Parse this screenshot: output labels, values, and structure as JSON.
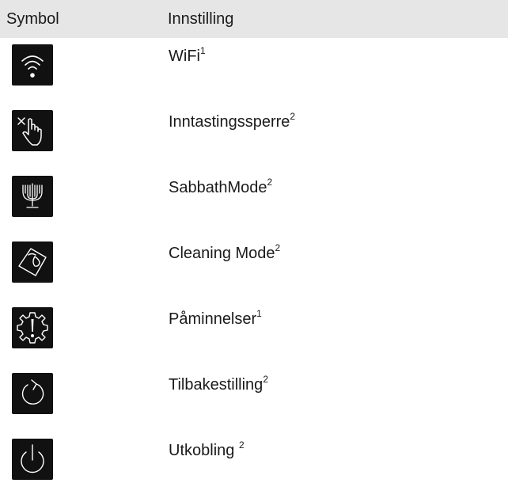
{
  "table": {
    "headers": {
      "symbol": "Symbol",
      "setting": "Innstilling"
    },
    "rows": [
      {
        "icon": "wifi-icon",
        "label": "WiFi",
        "note": "1"
      },
      {
        "icon": "touch-lock-icon",
        "label": "Inntastingssperre",
        "note": "2"
      },
      {
        "icon": "menorah-icon",
        "label": "SabbathMode",
        "note": "2"
      },
      {
        "icon": "cleaning-cloth-icon",
        "label": "Cleaning Mode",
        "note": "2"
      },
      {
        "icon": "gear-warning-icon",
        "label": "Påminnelser",
        "note": "1"
      },
      {
        "icon": "reset-icon",
        "label": "Tilbakestilling",
        "note": "2"
      },
      {
        "icon": "power-icon",
        "label": "Utkobling ",
        "note": "2"
      }
    ]
  }
}
